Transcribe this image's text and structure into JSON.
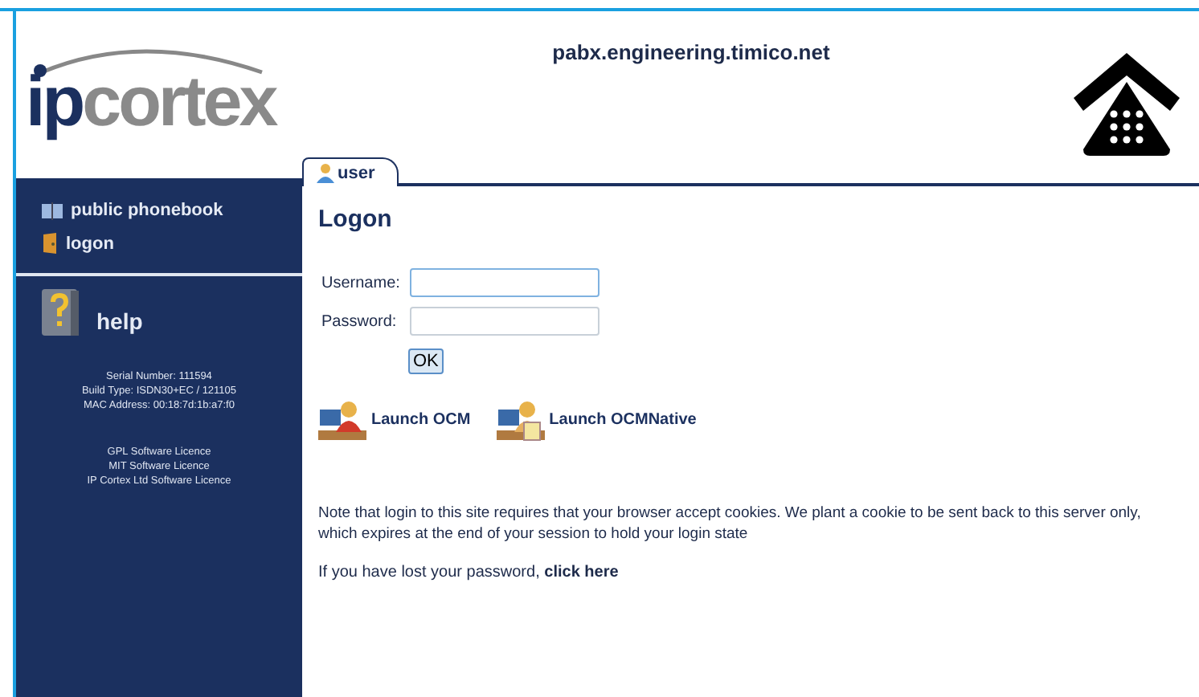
{
  "header": {
    "logo": {
      "prefix": "ip",
      "suffix": "cortex"
    },
    "hostname": "pabx.engineering.timico.net"
  },
  "tabs": [
    {
      "label": "user",
      "selected": true
    }
  ],
  "sidebar": {
    "items": [
      {
        "label": "public phonebook",
        "kind": "book"
      },
      {
        "label": "logon",
        "kind": "door"
      }
    ],
    "help": {
      "title": "help",
      "info": [
        "Serial Number: 111594",
        "Build Type: ISDN30+EC / 121105",
        "MAC Address: 00:18:7d:1b:a7:f0"
      ],
      "licences": [
        "GPL Software Licence",
        "MIT Software Licence",
        "IP Cortex Ltd Software Licence"
      ]
    }
  },
  "page": {
    "title": "Logon",
    "fields": [
      {
        "label": "Username:",
        "focused": true
      },
      {
        "label": "Password:",
        "focused": false
      }
    ],
    "submit": "OK",
    "launchers": [
      {
        "label": "Launch OCM",
        "kind": "web"
      },
      {
        "label": "Launch OCMNative",
        "kind": "native"
      }
    ],
    "note": "Note that login to this site requires that your browser accept cookies. We plant a cookie to be sent back to this server only, which expires at the end of your session to hold your login state",
    "lost": {
      "text": "If you have lost your password,",
      "link": "click here"
    }
  }
}
